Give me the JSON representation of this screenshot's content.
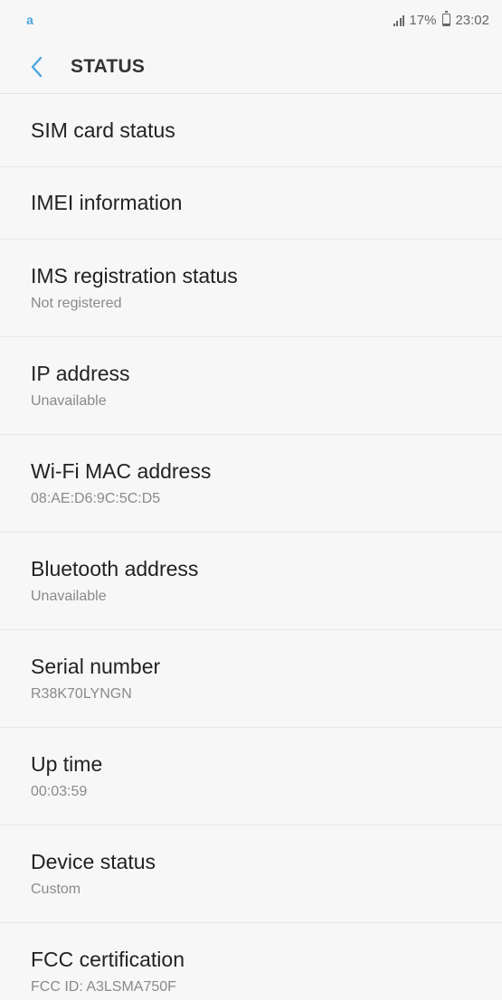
{
  "status_bar": {
    "notification_icon": "a",
    "battery_percent": "17%",
    "time": "23:02"
  },
  "app_bar": {
    "title": "STATUS"
  },
  "items": [
    {
      "title": "SIM card status"
    },
    {
      "title": "IMEI information"
    },
    {
      "title": "IMS registration status",
      "subtitle": "Not registered"
    },
    {
      "title": "IP address",
      "subtitle": "Unavailable"
    },
    {
      "title": "Wi-Fi MAC address",
      "subtitle": "08:AE:D6:9C:5C:D5"
    },
    {
      "title": "Bluetooth address",
      "subtitle": "Unavailable"
    },
    {
      "title": "Serial number",
      "subtitle": "R38K70LYNGN"
    },
    {
      "title": "Up time",
      "subtitle": "00:03:59"
    },
    {
      "title": "Device status",
      "subtitle": "Custom"
    },
    {
      "title": "FCC certification",
      "subtitle": "FCC ID: A3LSMA750F"
    }
  ],
  "colors": {
    "accent": "#4aa6e0",
    "background": "#f7f7f7",
    "title_text": "#222222",
    "subtitle_text": "#8a8a8a",
    "divider": "#e7e7e7"
  },
  "icons": {
    "notification": "app-notification-icon",
    "signal": "signal-icon",
    "battery": "battery-icon",
    "back": "back-arrow-icon"
  }
}
